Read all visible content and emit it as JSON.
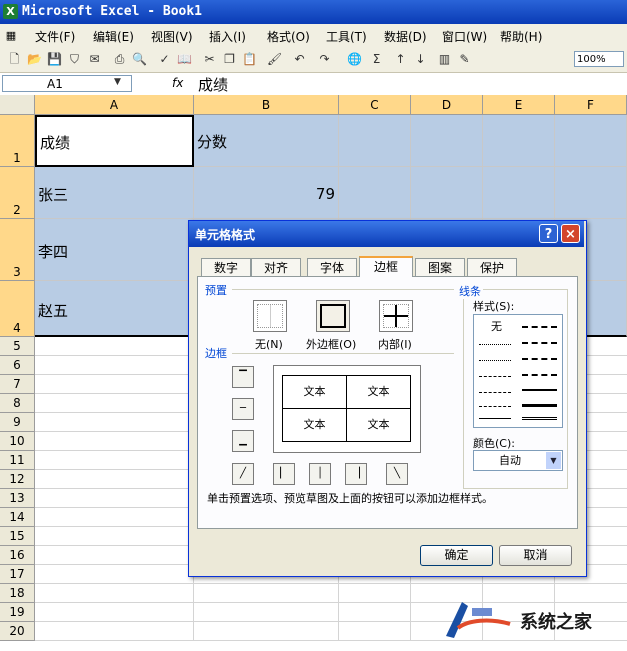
{
  "window": {
    "title": "Microsoft Excel - Book1"
  },
  "menubar": {
    "items": [
      "文件(F)",
      "编辑(E)",
      "视图(V)",
      "插入(I)",
      "格式(O)",
      "工具(T)",
      "数据(D)",
      "窗口(W)",
      "帮助(H)"
    ]
  },
  "toolbar": {
    "zoom": "100%"
  },
  "formula_bar": {
    "name_box": "A1",
    "fx_label": "fx",
    "formula": "成绩"
  },
  "sheet": {
    "columns": [
      "A",
      "B",
      "C",
      "D",
      "E",
      "F"
    ],
    "rows": [
      "1",
      "2",
      "3",
      "4",
      "5",
      "6",
      "7",
      "8",
      "9",
      "10",
      "11",
      "12",
      "13",
      "14",
      "15",
      "16",
      "17",
      "18",
      "19",
      "20"
    ],
    "cells": {
      "a1": "成绩",
      "b1": "分数",
      "a2": "张三",
      "b2": "79",
      "a3": "李四",
      "a4": "赵五"
    }
  },
  "dialog": {
    "title": "单元格格式",
    "help_label": "?",
    "close_label": "×",
    "tabs": [
      "数字",
      "对齐",
      "字体",
      "边框",
      "图案",
      "保护"
    ],
    "active_tab": "边框",
    "presets_label": "预置",
    "presets": [
      "无(N)",
      "外边框(O)",
      "内部(I)"
    ],
    "border_label": "边框",
    "preview_text": [
      "文本",
      "文本",
      "文本",
      "文本"
    ],
    "line_label": "线条",
    "style_label": "样式(S):",
    "style_none": "无",
    "color_label": "颜色(C):",
    "color_value": "自动",
    "help_text": "单击预置选项、预览草图及上面的按钮可以添加边框样式。",
    "ok_label": "确定",
    "cancel_label": "取消"
  },
  "watermark": {
    "text": "系统之家"
  }
}
